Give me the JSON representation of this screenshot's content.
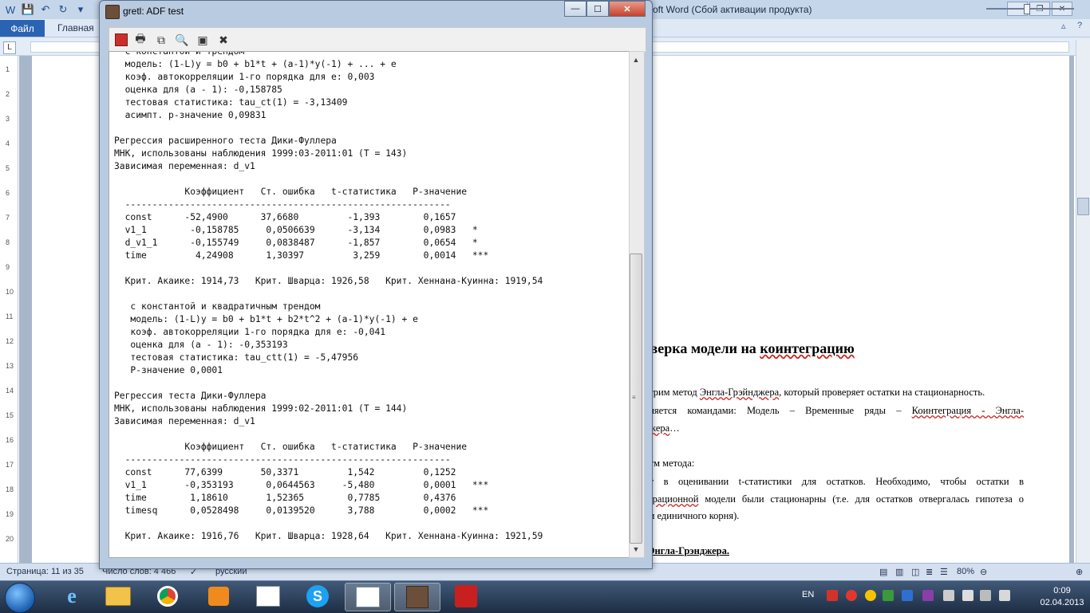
{
  "word": {
    "title": "oft Word (Сбой активации продукта)",
    "tab_file": "Файл",
    "tab_home": "Главная",
    "ruler_corner": "L",
    "vruler_numbers": [
      "1",
      "2",
      "3",
      "4",
      "5",
      "6",
      "7",
      "8",
      "9",
      "10",
      "11",
      "12",
      "13",
      "14",
      "15",
      "16",
      "17",
      "18",
      "19",
      "20"
    ],
    "heading_prefix": "оверка модели на ",
    "heading_underlined": "коинтеграцию",
    "body_lines": [
      {
        "pre": "отрим метод ",
        "spell": "Энгла-Грэйнджера",
        "post": ", который проверяет остатки на стационарность."
      },
      {
        "pre": "лняется командами: Модель – Временные ряды – ",
        "spell": "Коинтеграция - Энгла-",
        "post": ""
      },
      {
        "pre": "",
        "spell": "джера",
        "post": "…"
      },
      {
        "pre": "итм метода:",
        "spell": "",
        "post": ""
      },
      {
        "pre": "ит в оценивании t-статистики для остатков. Необходимо, чтобы остатки в",
        "spell": "",
        "post": ""
      },
      {
        "pre": "",
        "spell": "еграционной",
        "post": " модели были стационарны (т.е. для остатков отвергалась гипотеза о"
      },
      {
        "pre": "ии единичного корня).",
        "spell": "",
        "post": ""
      }
    ],
    "doc_ref": "Энгла-Грэнджера.",
    "status": {
      "page": "Страница: 11 из 35",
      "words": "Число слов: 4 466",
      "lang": "русский",
      "zoom": "80%"
    }
  },
  "gretl": {
    "title": "gretl: ADF test",
    "output_lines": [
      "  с константой и трендом",
      "  модель: (1-L)y = b0 + b1*t + (a-1)*y(-1) + ... + e",
      "  коэф. автокорреляции 1-го порядка для e: 0,003",
      "  оценка для (a - 1): -0,158785",
      "  тестовая статистика: tau_ct(1) = -3,13409",
      "  асимпт. р-значение 0,09831",
      "",
      "Регрессия расширенного теста Дики-Фуллера",
      "МНК, использованы наблюдения 1999:03-2011:01 (T = 143)",
      "Зависимая переменная: d_v1",
      "",
      "             Коэффициент   Ст. ошибка   t-статистика   Р-значение",
      "  ------------------------------------------------------------",
      "  const      -52,4900      37,6680         -1,393        0,1657",
      "  v1_1        -0,158785     0,0506639      -3,134        0,0983   *",
      "  d_v1_1      -0,155749     0,0838487      -1,857        0,0654   *",
      "  time         4,24908      1,30397         3,259        0,0014   ***",
      "",
      "  Крит. Акаике: 1914,73   Крит. Шварца: 1926,58   Крит. Хеннана-Куинна: 1919,54",
      "",
      "   с константой и квадратичным трендом",
      "   модель: (1-L)y = b0 + b1*t + b2*t^2 + (a-1)*y(-1) + e",
      "   коэф. автокорреляции 1-го порядка для e: -0,041",
      "   оценка для (a - 1): -0,353193",
      "   тестовая статистика: tau_ctt(1) = -5,47956",
      "   Р-значение 0,0001",
      "",
      "Регрессия теста Дики-Фуллера",
      "МНК, использованы наблюдения 1999:02-2011:01 (T = 144)",
      "Зависимая переменная: d_v1",
      "",
      "             Коэффициент   Ст. ошибка   t-статистика   Р-значение",
      "  ------------------------------------------------------------",
      "  const      77,6399       50,3371         1,542         0,1252",
      "  v1_1       -0,353193      0,0644563     -5,480         0,0001   ***",
      "  time        1,18610       1,52365        0,7785        0,4376",
      "  timesq      0,0528498     0,0139520      3,788         0,0002   ***",
      "",
      "  Крит. Акаике: 1916,76   Крит. Шварца: 1928,64   Крит. Хеннана-Куинна: 1921,59"
    ]
  },
  "taskbar": {
    "lang": "EN",
    "time": "0:09",
    "date": "02.04.2013"
  }
}
